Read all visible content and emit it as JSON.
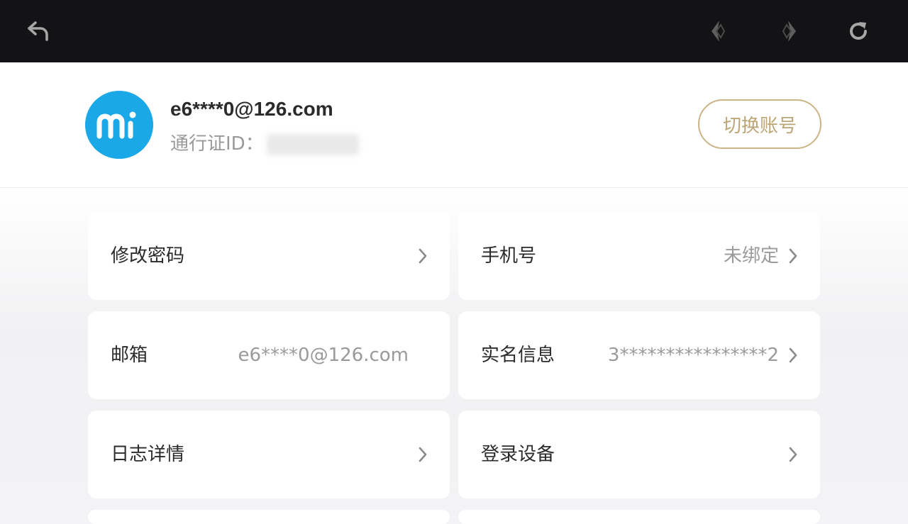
{
  "topbar": {
    "back_icon": "back-arrow-icon",
    "prev_icon": "prev-diamond-icon",
    "next_icon": "next-diamond-icon",
    "refresh_icon": "refresh-icon"
  },
  "account": {
    "avatar_logo": "mi",
    "email": "e6****0@126.com",
    "passport_label": "通行证ID：",
    "switch_button": "切换账号"
  },
  "cards": {
    "change_password": {
      "label": "修改密码"
    },
    "phone": {
      "label": "手机号",
      "value": "未绑定"
    },
    "email": {
      "label": "邮箱",
      "value": "e6****0@126.com"
    },
    "real_name": {
      "label": "实名信息",
      "value": "3****************2"
    },
    "log_details": {
      "label": "日志详情"
    },
    "login_devices": {
      "label": "登录设备"
    }
  },
  "colors": {
    "topbar_bg": "#131315",
    "avatar_bg": "#1aa8e8",
    "accent_gold": "#cbb487"
  }
}
